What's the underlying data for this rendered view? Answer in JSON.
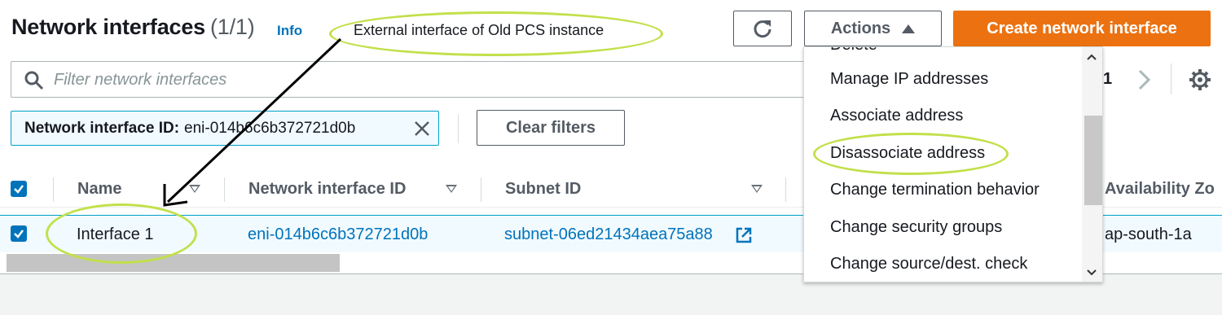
{
  "header": {
    "title": "Network interfaces",
    "count": "(1/1)",
    "info_link": "Info",
    "callout": "External interface of Old PCS instance"
  },
  "toolbar": {
    "actions_label": "Actions",
    "create_label": "Create network interface"
  },
  "search": {
    "placeholder": "Filter network interfaces"
  },
  "filter_token": {
    "key": "Network interface ID:",
    "value": "eni-014b6c6b372721d0b"
  },
  "clear_filters_label": "Clear filters",
  "pagination": {
    "page": "1"
  },
  "table": {
    "columns": [
      "Name",
      "Network interface ID",
      "Subnet ID",
      "Availability Zo"
    ],
    "rows": [
      {
        "name": "Interface 1",
        "interface_id": "eni-014b6c6b372721d0b",
        "subnet_id": "subnet-06ed21434aea75a88",
        "az": "ap-south-1a"
      }
    ]
  },
  "actions_menu": {
    "items": [
      "Delete",
      "Manage IP addresses",
      "Associate address",
      "Disassociate address",
      "Change termination behavior",
      "Change security groups",
      "Change source/dest. check"
    ]
  },
  "colors": {
    "primary": "#ec7211",
    "link": "#0073bb",
    "annotation": "#c2e04a"
  }
}
